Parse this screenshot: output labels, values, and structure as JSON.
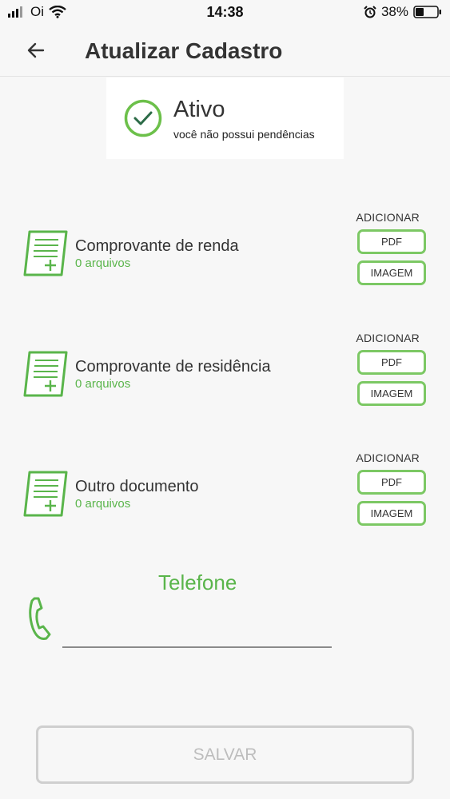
{
  "status_bar": {
    "carrier": "Oi",
    "time": "14:38",
    "battery": "38%"
  },
  "header": {
    "title": "Atualizar Cadastro",
    "back_icon": "arrow-left-icon"
  },
  "status_card": {
    "title": "Ativo",
    "subtitle": "você não possui pendências",
    "icon": "check-circle-icon"
  },
  "documents": [
    {
      "name": "Comprovante de renda",
      "count": "0 arquivos",
      "add_label": "ADICIONAR",
      "pdf_label": "PDF",
      "image_label": "IMAGEM"
    },
    {
      "name": "Comprovante de residência",
      "count": "0 arquivos",
      "add_label": "ADICIONAR",
      "pdf_label": "PDF",
      "image_label": "IMAGEM"
    },
    {
      "name": "Outro documento",
      "count": "0 arquivos",
      "add_label": "ADICIONAR",
      "pdf_label": "PDF",
      "image_label": "IMAGEM"
    }
  ],
  "phone": {
    "label": "Telefone",
    "value": "",
    "icon": "phone-icon"
  },
  "save_label": "SALVAR",
  "colors": {
    "accent": "#5ab54b",
    "pill_border": "#7cc864",
    "disabled": "#bdbdbd"
  }
}
